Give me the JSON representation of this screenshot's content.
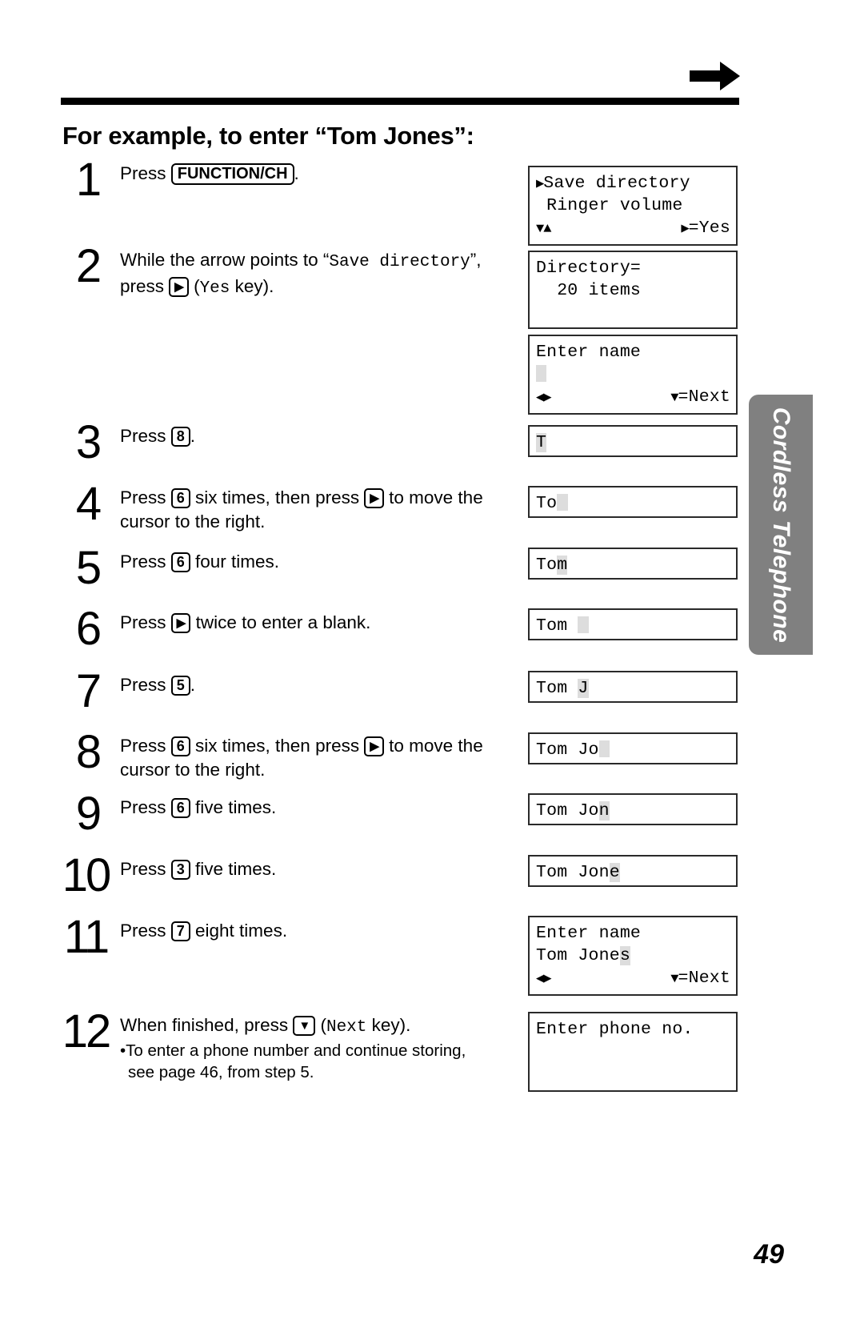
{
  "header": {
    "arrow_icon": "right-arrow-icon",
    "rule": "horizontal-rule"
  },
  "title": "For example, to enter “Tom Jones”:",
  "steps": [
    {
      "number": "1",
      "parts": [
        {
          "type": "text",
          "value": "Press "
        },
        {
          "type": "key",
          "value": "FUNCTION/CH"
        },
        {
          "type": "text",
          "value": "."
        }
      ]
    },
    {
      "number": "2",
      "parts": [
        {
          "type": "text",
          "value": "While the arrow points to “"
        },
        {
          "type": "mono",
          "value": "Save directory"
        },
        {
          "type": "text",
          "value": "”, press "
        },
        {
          "type": "key-arrow",
          "value": "▶"
        },
        {
          "type": "text",
          "value": " ("
        },
        {
          "type": "mono",
          "value": "Yes"
        },
        {
          "type": "text",
          "value": " key)."
        }
      ]
    },
    {
      "number": "3",
      "parts": [
        {
          "type": "text",
          "value": "Press "
        },
        {
          "type": "key-num",
          "value": "8"
        },
        {
          "type": "text",
          "value": "."
        }
      ]
    },
    {
      "number": "4",
      "parts": [
        {
          "type": "text",
          "value": "Press "
        },
        {
          "type": "key-num",
          "value": "6"
        },
        {
          "type": "text",
          "value": " six times, then press "
        },
        {
          "type": "key-arrow",
          "value": "▶"
        },
        {
          "type": "text",
          "value": " to move the cursor to the right."
        }
      ]
    },
    {
      "number": "5",
      "parts": [
        {
          "type": "text",
          "value": "Press "
        },
        {
          "type": "key-num",
          "value": "6"
        },
        {
          "type": "text",
          "value": " four times."
        }
      ]
    },
    {
      "number": "6",
      "parts": [
        {
          "type": "text",
          "value": "Press "
        },
        {
          "type": "key-arrow",
          "value": "▶"
        },
        {
          "type": "text",
          "value": " twice to enter a blank."
        }
      ]
    },
    {
      "number": "7",
      "parts": [
        {
          "type": "text",
          "value": "Press "
        },
        {
          "type": "key-num",
          "value": "5"
        },
        {
          "type": "text",
          "value": "."
        }
      ]
    },
    {
      "number": "8",
      "parts": [
        {
          "type": "text",
          "value": "Press "
        },
        {
          "type": "key-num",
          "value": "6"
        },
        {
          "type": "text",
          "value": " six times, then press "
        },
        {
          "type": "key-arrow",
          "value": "▶"
        },
        {
          "type": "text",
          "value": " to move the cursor to the right."
        }
      ]
    },
    {
      "number": "9",
      "parts": [
        {
          "type": "text",
          "value": "Press "
        },
        {
          "type": "key-num",
          "value": "6"
        },
        {
          "type": "text",
          "value": " five times."
        }
      ]
    },
    {
      "number": "10",
      "parts": [
        {
          "type": "text",
          "value": "Press "
        },
        {
          "type": "key-num",
          "value": "3"
        },
        {
          "type": "text",
          "value": " five times."
        }
      ]
    },
    {
      "number": "11",
      "parts": [
        {
          "type": "text",
          "value": "Press "
        },
        {
          "type": "key-num",
          "value": "7"
        },
        {
          "type": "text",
          "value": " eight times."
        }
      ]
    },
    {
      "number": "12",
      "parts": [
        {
          "type": "text",
          "value": "When finished, press "
        },
        {
          "type": "key-arrow",
          "value": "▼"
        },
        {
          "type": "text",
          "value": " ("
        },
        {
          "type": "mono",
          "value": "Next"
        },
        {
          "type": "text",
          "value": " key)."
        }
      ],
      "bullet": "•To enter a phone number and continue storing, see page 46, from step 5."
    }
  ],
  "lcd_panels": [
    {
      "name": "save-directory-menu",
      "lines": [
        [
          {
            "type": "tri",
            "value": "▶"
          },
          {
            "type": "text",
            "value": "Save directory"
          }
        ],
        [
          {
            "type": "text",
            "value": " Ringer volume"
          }
        ],
        [
          {
            "type": "tri",
            "value": "▼▲"
          },
          {
            "type": "right",
            "parts": [
              {
                "type": "tri",
                "value": "▶"
              },
              {
                "type": "text",
                "value": "=Yes"
              }
            ]
          }
        ]
      ]
    },
    {
      "name": "directory-count",
      "lines": [
        [
          {
            "type": "text",
            "value": "Directory="
          }
        ],
        [
          {
            "type": "text",
            "value": "  20 items"
          }
        ],
        [
          {
            "type": "text",
            "value": ""
          }
        ]
      ]
    },
    {
      "name": "enter-name-empty",
      "lines": [
        [
          {
            "type": "text",
            "value": "Enter name"
          }
        ],
        [
          {
            "type": "cursor"
          }
        ],
        [
          {
            "type": "tri",
            "value": "◀▶"
          },
          {
            "type": "right",
            "parts": [
              {
                "type": "tri",
                "value": "▼"
              },
              {
                "type": "text",
                "value": "=Next"
              }
            ]
          }
        ]
      ]
    },
    {
      "name": "name-T",
      "lines": [
        [
          {
            "type": "hl",
            "value": "T"
          }
        ]
      ]
    },
    {
      "name": "name-To-cursor",
      "lines": [
        [
          {
            "type": "text",
            "value": "To"
          },
          {
            "type": "cursor"
          }
        ]
      ]
    },
    {
      "name": "name-Tom",
      "lines": [
        [
          {
            "type": "text",
            "value": "To"
          },
          {
            "type": "hl",
            "value": "m"
          }
        ]
      ]
    },
    {
      "name": "name-Tom-blank-cursor",
      "lines": [
        [
          {
            "type": "text",
            "value": "Tom "
          },
          {
            "type": "cursor"
          }
        ]
      ]
    },
    {
      "name": "name-Tom-J",
      "lines": [
        [
          {
            "type": "text",
            "value": "Tom "
          },
          {
            "type": "hl",
            "value": "J"
          }
        ]
      ]
    },
    {
      "name": "name-Tom-Jo-cursor",
      "lines": [
        [
          {
            "type": "text",
            "value": "Tom Jo"
          },
          {
            "type": "cursor"
          }
        ]
      ]
    },
    {
      "name": "name-Tom-Jon",
      "lines": [
        [
          {
            "type": "text",
            "value": "Tom Jo"
          },
          {
            "type": "hl",
            "value": "n"
          }
        ]
      ]
    },
    {
      "name": "name-Tom-Jone",
      "lines": [
        [
          {
            "type": "text",
            "value": "Tom Jon"
          },
          {
            "type": "hl",
            "value": "e"
          }
        ]
      ]
    },
    {
      "name": "enter-name-tom-jones",
      "lines": [
        [
          {
            "type": "text",
            "value": "Enter name"
          }
        ],
        [
          {
            "type": "text",
            "value": "Tom Jone"
          },
          {
            "type": "hl",
            "value": "s"
          }
        ],
        [
          {
            "type": "tri",
            "value": "◀▶"
          },
          {
            "type": "right",
            "parts": [
              {
                "type": "tri",
                "value": "▼"
              },
              {
                "type": "text",
                "value": "=Next"
              }
            ]
          }
        ]
      ]
    },
    {
      "name": "enter-phone-no",
      "lines": [
        [
          {
            "type": "text",
            "value": "Enter phone no."
          }
        ],
        [
          {
            "type": "text",
            "value": ""
          }
        ],
        [
          {
            "type": "text",
            "value": ""
          }
        ]
      ]
    }
  ],
  "side_tab": {
    "label": "Cordless Telephone",
    "color": "#808080"
  },
  "page_number": "49"
}
